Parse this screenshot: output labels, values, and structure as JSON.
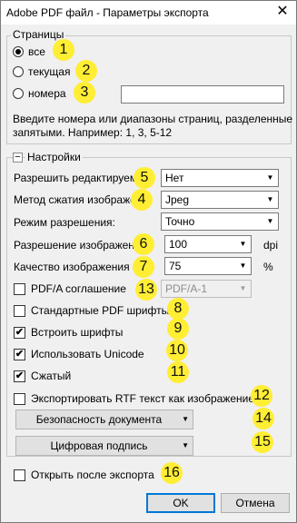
{
  "window": {
    "title": "Adobe PDF файл - Параметры экспорта",
    "close_glyph": "✕"
  },
  "pages": {
    "caption": "Страницы",
    "all_label": "все",
    "current_label": "текущая",
    "numbers_label": "номера",
    "numbers_value": "",
    "hint_line1": "Введите номера или диапазоны страниц, разделенные",
    "hint_line2": "запятыми. Например: 1, 3, 5-12"
  },
  "settings": {
    "caption": "Настройки",
    "collapse_glyph": "−",
    "allow_edit_label": "Разрешить редактируемые",
    "allow_edit_value": "Нет",
    "compression_label": "Метод сжатия изображени",
    "compression_value": "Jpeg",
    "resolution_mode_label": "Режим разрешения:",
    "resolution_mode_value": "Точно",
    "image_resolution_label": "Разрешение изображения",
    "image_resolution_value": "100",
    "image_resolution_unit": "dpi",
    "image_quality_label": "Качество изображения",
    "image_quality_value": "75",
    "image_quality_unit": "%",
    "pdfa_label": "PDF/A соглашение",
    "pdfa_value": "PDF/A-1",
    "std_fonts_label": "Стандартные PDF шрифты",
    "embed_fonts_label": "Встроить шрифты",
    "unicode_label": "Использовать Unicode",
    "compressed_label": "Сжатый",
    "rtf_label": "Экспортировать RTF текст как изображение",
    "security_label": "Безопасность документа",
    "signature_label": "Цифровая подпись"
  },
  "checks": {
    "pdfa": false,
    "std_fonts": false,
    "embed_fonts": true,
    "unicode": true,
    "compressed": true,
    "rtf": false,
    "open_after": false
  },
  "open_after_label": "Открыть после экспорта",
  "buttons": {
    "ok": "OK",
    "cancel": "Отмена"
  },
  "badges": [
    "1",
    "2",
    "3",
    "4",
    "5",
    "6",
    "7",
    "8",
    "9",
    "10",
    "11",
    "12",
    "13",
    "14",
    "15",
    "16"
  ],
  "colors": {
    "badge": "#ffee33",
    "accent": "#0078d7"
  }
}
